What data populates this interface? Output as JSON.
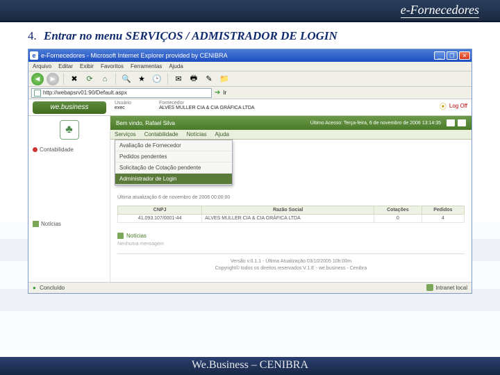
{
  "slide": {
    "header_title": "e-Fornecedores",
    "step_number": "4.",
    "step_text": "Entrar no menu  SERVIÇOS / ADMISTRADOR DE LOGIN",
    "footer": "We.Business – CENIBRA"
  },
  "ie": {
    "title": "e-Fornecedores - Microsoft Internet Explorer provided by CENIBRA",
    "menu": [
      "Arquivo",
      "Editar",
      "Exibir",
      "Favoritos",
      "Ferramentas",
      "Ajuda"
    ],
    "address": "http://webapsrv01:90/Default.aspx",
    "go_label": "Ir",
    "status_left": "Concluído",
    "status_right": "Intranet local"
  },
  "page": {
    "logo_text": "we.business",
    "top_fields": {
      "usuario_label": "Usuário",
      "usuario_value": "exec",
      "fornecedor_label": "Fornecedor",
      "fornecedor_value": "ALVES MULLER CIA & CIA GRÁFICA LTDA"
    },
    "logoff": "Log Off",
    "left_brand_glyph": "♣",
    "left_section1": "Contabilidade",
    "welcome": "Bem vindo, Rafael Silva",
    "last_access": "Último Acesso: Terça-feira, 6 de novembro de 2006 13:14:35",
    "menu_items": [
      "Serviços",
      "Contabilidade",
      "Notícias",
      "Ajuda"
    ],
    "dropdown": {
      "items": [
        "Avaliação de Fornecedor",
        "Pedidos pendentes",
        "Solicitação de Cotação pendente",
        "Administrador de Login"
      ],
      "highlight_index": 3
    },
    "update_line": "Última atualização  6 de novembro de 2006 00:00:00",
    "table": {
      "headers": [
        "CNPJ",
        "Razão Social",
        "Cotações",
        "Pedidos"
      ],
      "row": [
        "41.093.107/0001-44",
        "ALVES MULLER CIA & CIA GRÁFICA LTDA",
        "0",
        "4"
      ]
    },
    "news_label": "Notícias",
    "no_news": "Nenhuma mensagem",
    "version_line1": "Versão v.0.1.1 - Última Atualização 03/10/2005 10h:00m",
    "version_line2": "Copyright© todos os direitos reservados V.1.E - we.business - Cenibra"
  }
}
